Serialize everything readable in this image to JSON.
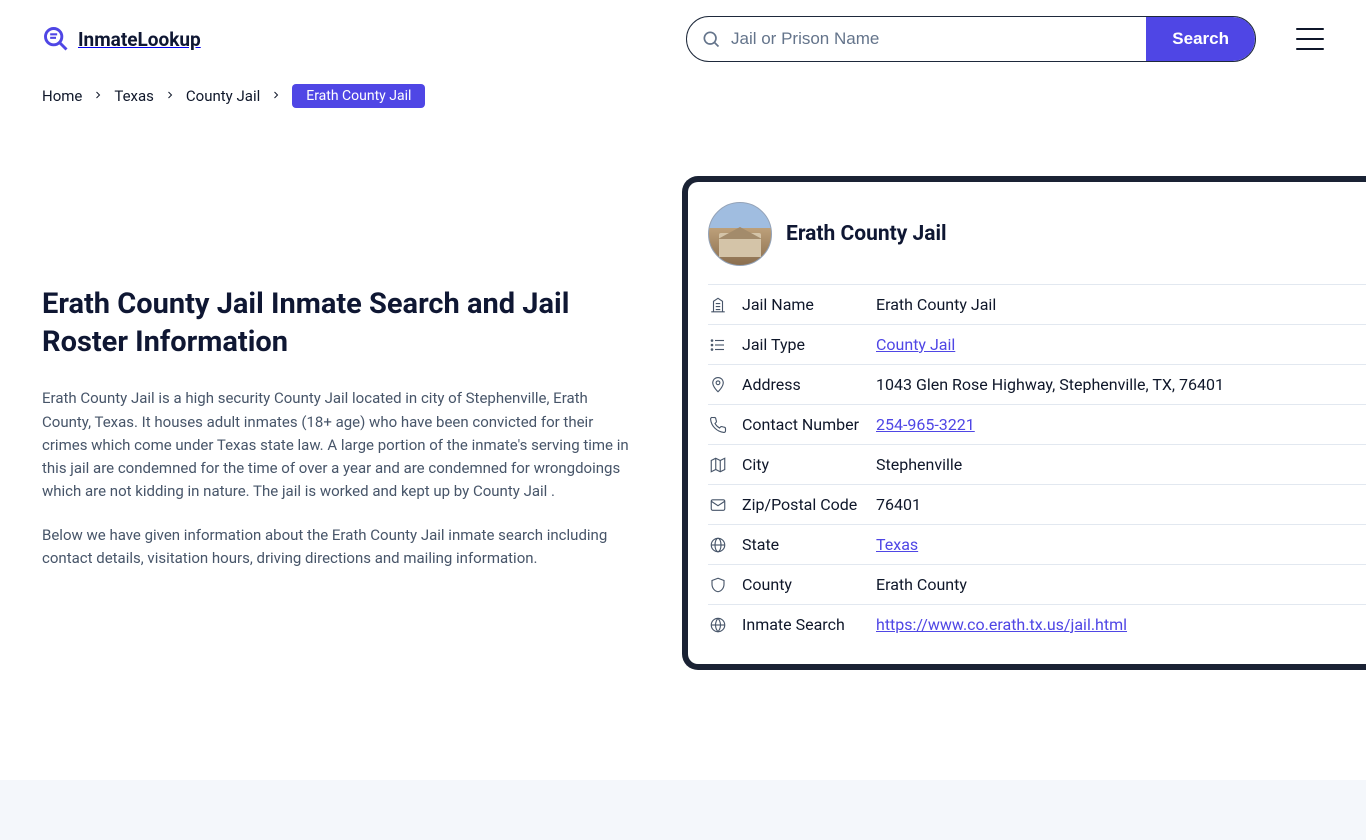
{
  "header": {
    "logo_text": "InmateLookup",
    "search_placeholder": "Jail or Prison Name",
    "search_button": "Search"
  },
  "breadcrumb": {
    "items": [
      "Home",
      "Texas",
      "County Jail"
    ],
    "current": "Erath County Jail"
  },
  "main": {
    "heading": "Erath County Jail Inmate Search and Jail Roster Information",
    "paragraph1": "Erath County Jail is a high security County Jail located in city of Stephenville, Erath County, Texas. It houses adult inmates (18+ age) who have been convicted for their crimes which come under Texas state law. A large portion of the inmate's serving time in this jail are condemned for the time of over a year and are condemned for wrongdoings which are not kidding in nature. The jail is worked and kept up by County Jail .",
    "paragraph2": "Below we have given information about the Erath County Jail inmate search including contact details, visitation hours, driving directions and mailing information."
  },
  "card": {
    "title": "Erath County Jail",
    "rows": [
      {
        "icon": "building",
        "label": "Jail Name",
        "value": "Erath County Jail",
        "link": false
      },
      {
        "icon": "list",
        "label": "Jail Type",
        "value": "County Jail",
        "link": true
      },
      {
        "icon": "pin",
        "label": "Address",
        "value": "1043 Glen Rose Highway, Stephenville, TX, 76401",
        "link": false
      },
      {
        "icon": "phone",
        "label": "Contact Number",
        "value": "254-965-3221",
        "link": true
      },
      {
        "icon": "map",
        "label": "City",
        "value": "Stephenville",
        "link": false
      },
      {
        "icon": "envelope",
        "label": "Zip/Postal Code",
        "value": "76401",
        "link": false
      },
      {
        "icon": "globe",
        "label": "State",
        "value": "Texas",
        "link": true
      },
      {
        "icon": "shield",
        "label": "County",
        "value": "Erath County",
        "link": false
      },
      {
        "icon": "web",
        "label": "Inmate Search",
        "value": "https://www.co.erath.tx.us/jail.html",
        "link": true
      }
    ]
  }
}
